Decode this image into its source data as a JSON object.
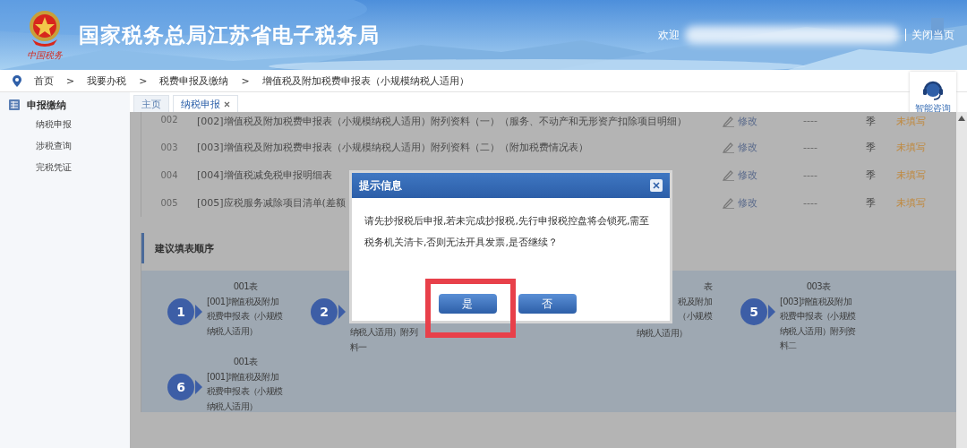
{
  "header": {
    "logo_caption": "中国税务",
    "title": "国家税务总局江苏省电子税务局",
    "welcome": "欢迎",
    "close_page": "关闭当页"
  },
  "breadcrumb": {
    "separator": ">",
    "items": [
      "首页",
      "我要办税",
      "税费申报及缴纳",
      "增值税及附加税费申报表（小规模纳税人适用）"
    ]
  },
  "help": {
    "label": "智能咨询"
  },
  "sidebar": {
    "title": "申报缴纳",
    "items": [
      {
        "label": "纳税申报",
        "selected": false
      },
      {
        "label": "涉税查询",
        "selected": false
      },
      {
        "label": "完税凭证",
        "selected": false
      }
    ]
  },
  "tabs": [
    {
      "label": "主页",
      "selected": false,
      "closable": false
    },
    {
      "label": "纳税申报",
      "selected": true,
      "closable": true
    }
  ],
  "table": {
    "rows": [
      {
        "number": "002",
        "title": "[002]增值税及附加税费申报表（小规模纳税人适用）附列资料（一）（服务、不动产和无形资产扣除项目明细）",
        "action": "修改",
        "column_4": "----",
        "period": "季",
        "status": "未填写"
      },
      {
        "number": "003",
        "title": "[003]增值税及附加税费申报表（小规模纳税人适用）附列资料（二）（附加税费情况表）",
        "action": "修改",
        "column_4": "----",
        "period": "季",
        "status": "未填写"
      },
      {
        "number": "004",
        "title": "[004]增值税减免税申报明细表",
        "action": "修改",
        "column_4": "----",
        "period": "季",
        "status": "未填写"
      },
      {
        "number": "005",
        "title": "[005]应税服务减除项目清单(差额",
        "action": "修改",
        "column_4": "----",
        "period": "季",
        "status": "未填写"
      }
    ]
  },
  "order": {
    "heading": "建议填表顺序",
    "steps": [
      {
        "number": "1",
        "lines": [
          {
            "text": "001表",
            "kind": "code"
          },
          {
            "text": "[001]增值税及附加",
            "kind": "line"
          },
          {
            "text": "税费申报表（小规模",
            "kind": "line"
          },
          {
            "text": "纳税人适用）",
            "kind": "line"
          }
        ]
      },
      {
        "number": "2",
        "lines": [
          {
            "text": "纳税人适用）附列",
            "kind": "line"
          },
          {
            "text": "料一",
            "kind": "line"
          }
        ]
      },
      {
        "lines": [
          {
            "text": "表",
            "kind": "clipped"
          },
          {
            "text": "税及附加",
            "kind": "clipped"
          },
          {
            "text": "（小规模",
            "kind": "clipped"
          },
          {
            "text": "纳税人适用）",
            "kind": "line"
          }
        ]
      },
      {
        "number": "5",
        "lines": [
          {
            "text": "003表",
            "kind": "code"
          },
          {
            "text": "[003]增值税及附加",
            "kind": "line"
          },
          {
            "text": "税费申报表（小规模",
            "kind": "line"
          },
          {
            "text": "纳税人适用）附列资",
            "kind": "line"
          },
          {
            "text": "料二",
            "kind": "line"
          }
        ]
      },
      {
        "number": "6",
        "lines": [
          {
            "text": "001表",
            "kind": "code"
          },
          {
            "text": "[001]增值税及附加",
            "kind": "line"
          },
          {
            "text": "税费申报表（小规模",
            "kind": "line"
          },
          {
            "text": "纳税人适用）",
            "kind": "line"
          }
        ]
      }
    ]
  },
  "dialog": {
    "title": "提示信息",
    "message": "请先抄报税后申报,若未完成抄报税,先行申报税控盘将会锁死,需至税务机关清卡,否则无法开具发票,是否继续？",
    "buttons": [
      {
        "label": "是",
        "highlighted": true
      },
      {
        "label": "否",
        "highlighted": false
      }
    ]
  }
}
